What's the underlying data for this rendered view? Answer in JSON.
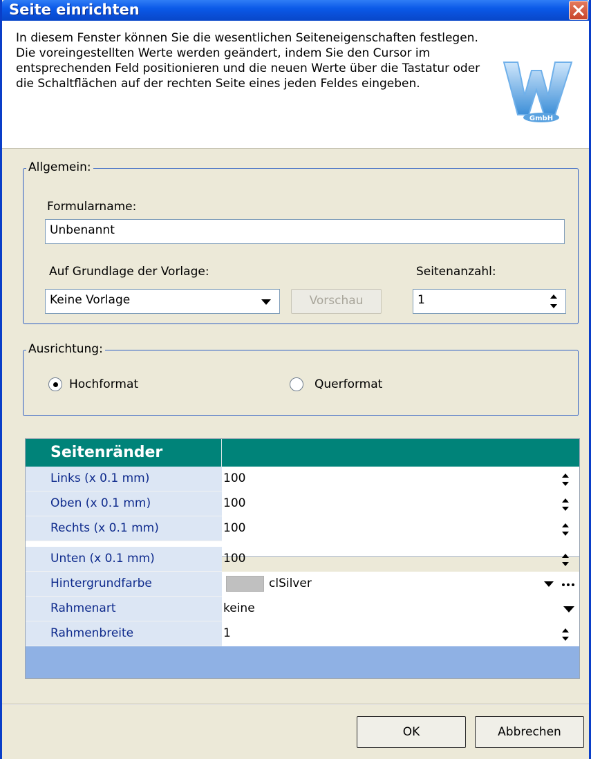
{
  "window": {
    "title": "Seite einrichten"
  },
  "header": {
    "description": "In diesem Fenster können Sie die wesentlichen Seiteneigenschaften festlegen. Die voreingestellten Werte werden geändert, indem Sie den Cursor im entsprechenden Feld positionieren und die neuen Werte über die Tastatur oder die Schaltflächen auf der rechten Seite eines jeden Feldes eingeben.",
    "logo_text": "GmbH"
  },
  "general": {
    "legend": "Allgemein:",
    "form_name_label": "Formularname:",
    "form_name_value": "Unbenannt",
    "template_label": "Auf Grundlage der Vorlage:",
    "template_value": "Keine Vorlage",
    "preview_button": "Vorschau",
    "page_count_label": "Seitenanzahl:",
    "page_count_value": "1"
  },
  "orientation": {
    "legend": "Ausrichtung:",
    "portrait": "Hochformat",
    "landscape": "Querformat",
    "selected": "portrait"
  },
  "margins": {
    "title": "Seitenränder",
    "rows": [
      {
        "label": "Links (x 0.1 mm)",
        "value": "100"
      },
      {
        "label": "Oben (x 0.1 mm)",
        "value": "100"
      },
      {
        "label": "Rechts (x 0.1 mm)",
        "value": "100"
      },
      {
        "label": "Unten (x 0.1 mm)",
        "value": "100"
      },
      {
        "label": "Hintergrundfarbe",
        "value": "clSilver"
      },
      {
        "label": "Rahmenart",
        "value": "keine"
      },
      {
        "label": "Rahmenbreite",
        "value": "1"
      }
    ],
    "header_color": "#008379",
    "swatch_color": "#c0c0c0"
  },
  "buttons": {
    "ok": "OK",
    "cancel": "Abbrechen"
  }
}
